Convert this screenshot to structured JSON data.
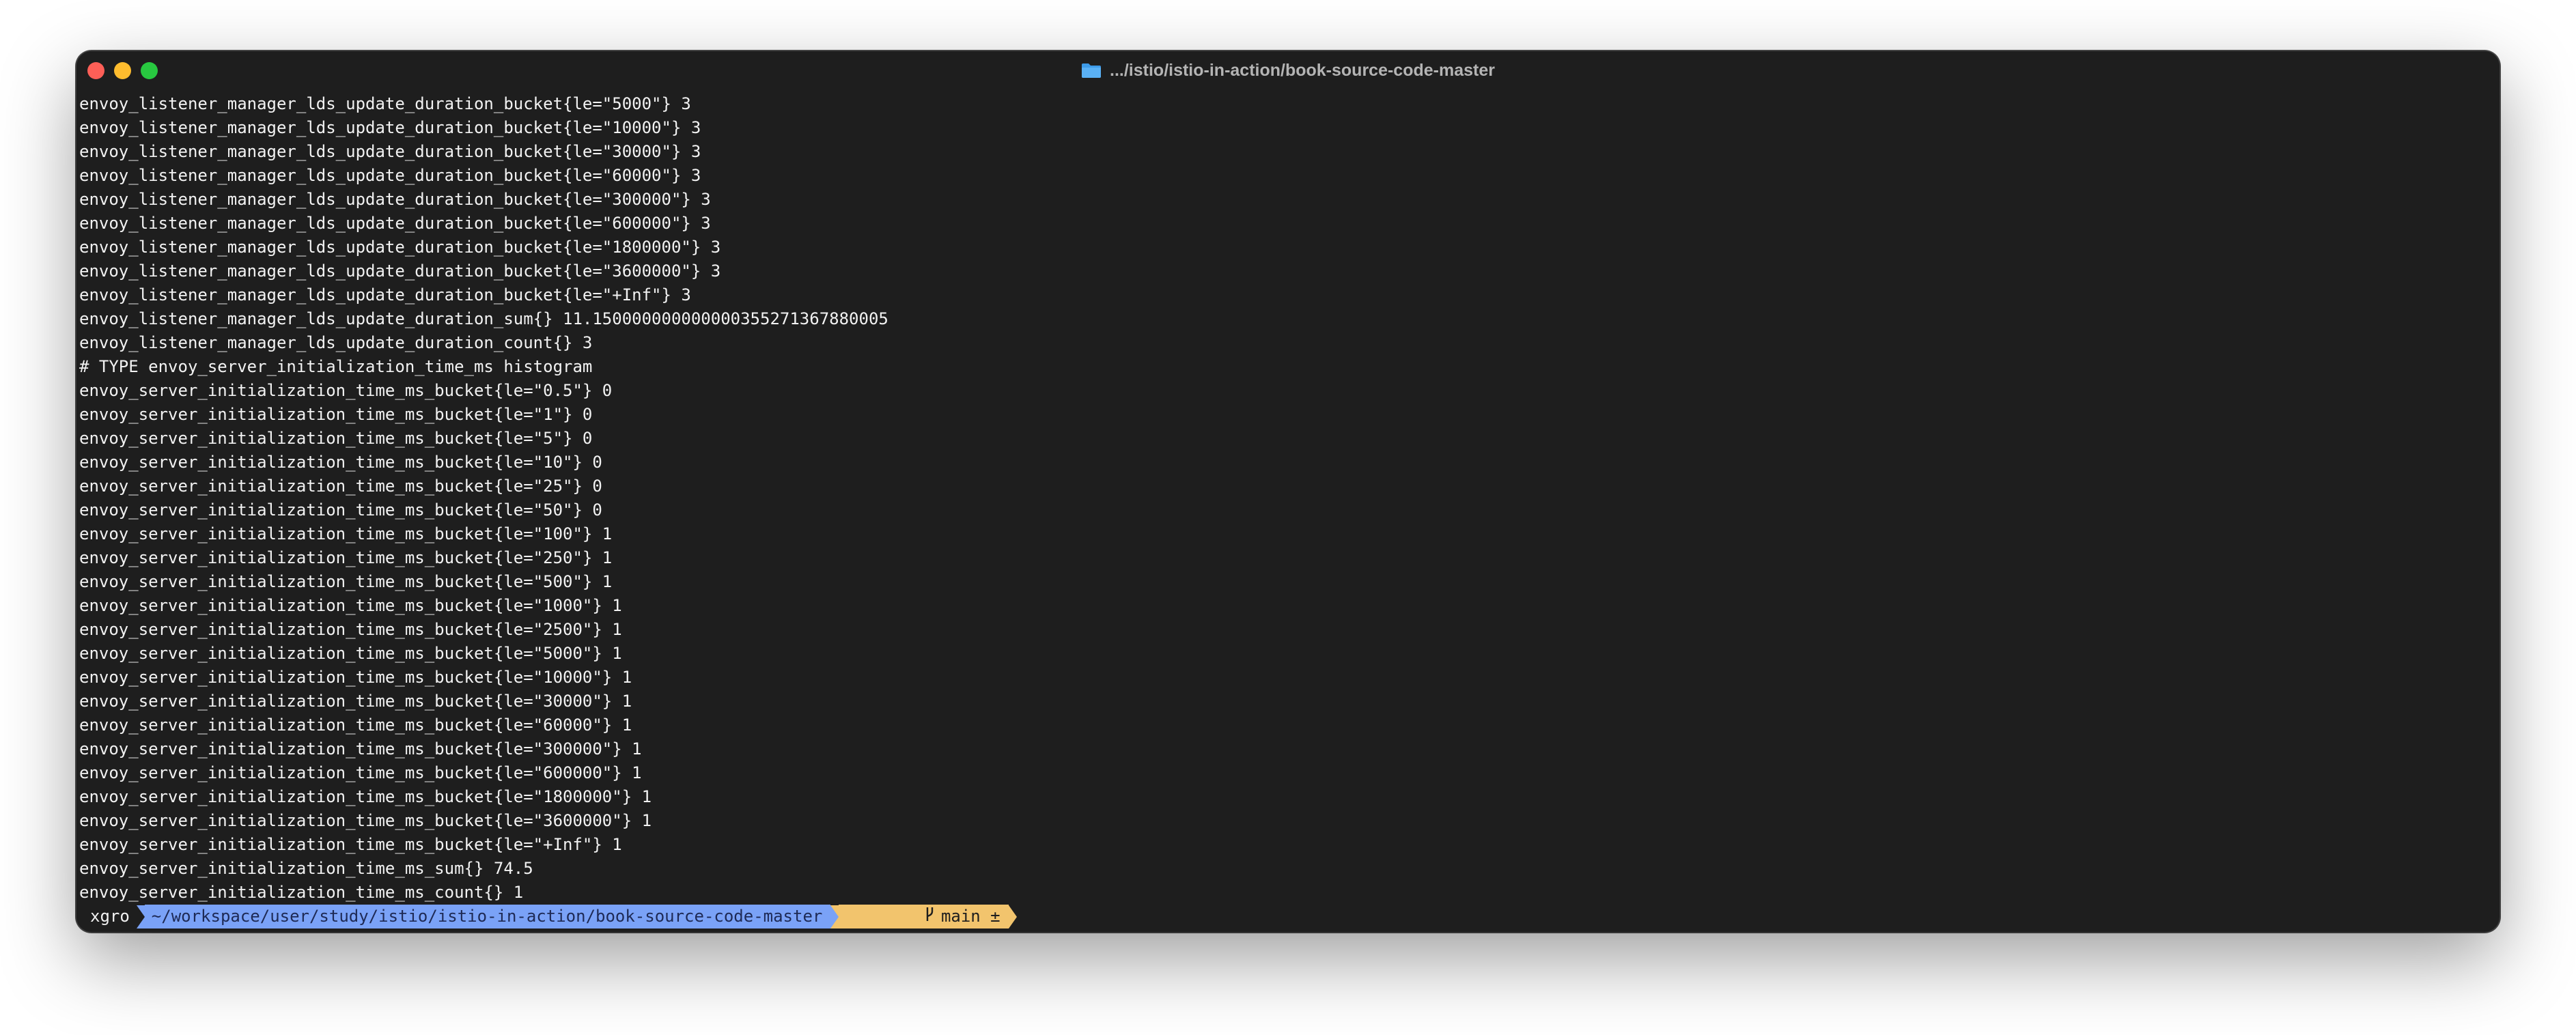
{
  "window": {
    "title": ".../istio/istio-in-action/book-source-code-master",
    "title_icon": "folder-icon",
    "colors": {
      "background": "#1e1e1e",
      "text": "#f2f2f2",
      "close": "#fe5f57",
      "minimize": "#febc2e",
      "maximize": "#28c840",
      "path_segment": "#7aa2f7",
      "git_segment": "#f2c46d"
    }
  },
  "output_lines": [
    "envoy_listener_manager_lds_update_duration_bucket{le=\"5000\"} 3",
    "envoy_listener_manager_lds_update_duration_bucket{le=\"10000\"} 3",
    "envoy_listener_manager_lds_update_duration_bucket{le=\"30000\"} 3",
    "envoy_listener_manager_lds_update_duration_bucket{le=\"60000\"} 3",
    "envoy_listener_manager_lds_update_duration_bucket{le=\"300000\"} 3",
    "envoy_listener_manager_lds_update_duration_bucket{le=\"600000\"} 3",
    "envoy_listener_manager_lds_update_duration_bucket{le=\"1800000\"} 3",
    "envoy_listener_manager_lds_update_duration_bucket{le=\"3600000\"} 3",
    "envoy_listener_manager_lds_update_duration_bucket{le=\"+Inf\"} 3",
    "envoy_listener_manager_lds_update_duration_sum{} 11.150000000000000355271367880005",
    "envoy_listener_manager_lds_update_duration_count{} 3",
    "# TYPE envoy_server_initialization_time_ms histogram",
    "envoy_server_initialization_time_ms_bucket{le=\"0.5\"} 0",
    "envoy_server_initialization_time_ms_bucket{le=\"1\"} 0",
    "envoy_server_initialization_time_ms_bucket{le=\"5\"} 0",
    "envoy_server_initialization_time_ms_bucket{le=\"10\"} 0",
    "envoy_server_initialization_time_ms_bucket{le=\"25\"} 0",
    "envoy_server_initialization_time_ms_bucket{le=\"50\"} 0",
    "envoy_server_initialization_time_ms_bucket{le=\"100\"} 1",
    "envoy_server_initialization_time_ms_bucket{le=\"250\"} 1",
    "envoy_server_initialization_time_ms_bucket{le=\"500\"} 1",
    "envoy_server_initialization_time_ms_bucket{le=\"1000\"} 1",
    "envoy_server_initialization_time_ms_bucket{le=\"2500\"} 1",
    "envoy_server_initialization_time_ms_bucket{le=\"5000\"} 1",
    "envoy_server_initialization_time_ms_bucket{le=\"10000\"} 1",
    "envoy_server_initialization_time_ms_bucket{le=\"30000\"} 1",
    "envoy_server_initialization_time_ms_bucket{le=\"60000\"} 1",
    "envoy_server_initialization_time_ms_bucket{le=\"300000\"} 1",
    "envoy_server_initialization_time_ms_bucket{le=\"600000\"} 1",
    "envoy_server_initialization_time_ms_bucket{le=\"1800000\"} 1",
    "envoy_server_initialization_time_ms_bucket{le=\"3600000\"} 1",
    "envoy_server_initialization_time_ms_bucket{le=\"+Inf\"} 1",
    "envoy_server_initialization_time_ms_sum{} 74.5",
    "envoy_server_initialization_time_ms_count{} 1"
  ],
  "prompt": {
    "user": "xgro",
    "path": "~/workspace/user/study/istio/istio-in-action/book-source-code-master",
    "branch_icon": "git-branch-icon",
    "branch": "main ±"
  }
}
